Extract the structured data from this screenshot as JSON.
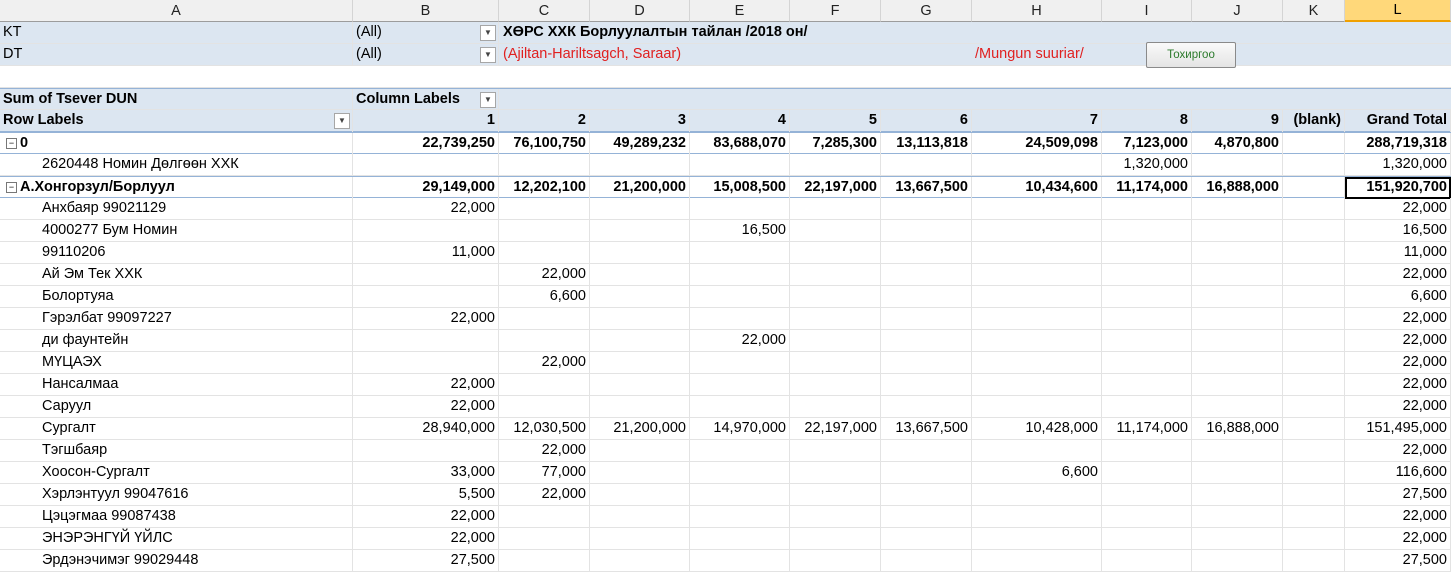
{
  "columns": [
    "A",
    "B",
    "C",
    "D",
    "E",
    "F",
    "G",
    "H",
    "I",
    "J",
    "K",
    "L"
  ],
  "filters": [
    {
      "name": "KT",
      "value": "(All)"
    },
    {
      "name": "DT",
      "value": "(All)"
    }
  ],
  "report_title": "ХӨРС ХХК Борлуулалтын тайлан /2018 он/",
  "report_subtitle": "(Ajiltan-Hariltsagch, Saraar)",
  "report_note": "/Mungun suuriar/",
  "button_label": "Тохиргоо",
  "pivot": {
    "value_field": "Sum of Tsever DUN",
    "column_labels": "Column Labels",
    "row_labels": "Row Labels",
    "col_headers": [
      "1",
      "2",
      "3",
      "4",
      "5",
      "6",
      "7",
      "8",
      "9",
      "(blank)",
      "Grand Total"
    ]
  },
  "rows": [
    {
      "label": "0",
      "kind": "group",
      "expand": "⊟",
      "vals": [
        "22,739,250",
        "76,100,750",
        "49,289,232",
        "83,688,070",
        "7,285,300",
        "13,113,818",
        "24,509,098",
        "7,123,000",
        "4,870,800",
        "",
        "288,719,318"
      ]
    },
    {
      "label": "2620448 Номин Дөлгөөн ХХК",
      "kind": "item",
      "vals": [
        "",
        "",
        "",
        "",
        "",
        "",
        "",
        "1,320,000",
        "",
        "",
        "1,320,000"
      ]
    },
    {
      "label": "А.Хонгорзул/Борлуул",
      "kind": "group",
      "expand": "⊟",
      "vals": [
        "29,149,000",
        "12,202,100",
        "21,200,000",
        "15,008,500",
        "22,197,000",
        "13,667,500",
        "10,434,600",
        "11,174,000",
        "16,888,000",
        "",
        "151,920,700"
      ]
    },
    {
      "label": " Анхбаяр 99021129",
      "kind": "item",
      "vals": [
        "22,000",
        "",
        "",
        "",
        "",
        "",
        "",
        "",
        "",
        "",
        "22,000"
      ]
    },
    {
      "label": "4000277 Бум Номин",
      "kind": "item",
      "vals": [
        "",
        "",
        "",
        "16,500",
        "",
        "",
        "",
        "",
        "",
        "",
        "16,500"
      ]
    },
    {
      "label": "99110206",
      "kind": "item",
      "vals": [
        "11,000",
        "",
        "",
        "",
        "",
        "",
        "",
        "",
        "",
        "",
        "11,000"
      ]
    },
    {
      "label": "Ай Эм Тек ХХК",
      "kind": "item",
      "vals": [
        "",
        "22,000",
        "",
        "",
        "",
        "",
        "",
        "",
        "",
        "",
        "22,000"
      ]
    },
    {
      "label": "Болортуяа",
      "kind": "item",
      "vals": [
        "",
        "6,600",
        "",
        "",
        "",
        "",
        "",
        "",
        "",
        "",
        "6,600"
      ]
    },
    {
      "label": "Гэрэлбат 99097227",
      "kind": "item",
      "vals": [
        "22,000",
        "",
        "",
        "",
        "",
        "",
        "",
        "",
        "",
        "",
        "22,000"
      ]
    },
    {
      "label": "ди фаунтейн",
      "kind": "item",
      "vals": [
        "",
        "",
        "",
        "22,000",
        "",
        "",
        "",
        "",
        "",
        "",
        "22,000"
      ]
    },
    {
      "label": "МҮЦАЭХ",
      "kind": "item",
      "vals": [
        "",
        "22,000",
        "",
        "",
        "",
        "",
        "",
        "",
        "",
        "",
        "22,000"
      ]
    },
    {
      "label": "Нансалмаа",
      "kind": "item",
      "vals": [
        "22,000",
        "",
        "",
        "",
        "",
        "",
        "",
        "",
        "",
        "",
        "22,000"
      ]
    },
    {
      "label": "Саруул",
      "kind": "item",
      "vals": [
        "22,000",
        "",
        "",
        "",
        "",
        "",
        "",
        "",
        "",
        "",
        "22,000"
      ]
    },
    {
      "label": "Сургалт",
      "kind": "item",
      "vals": [
        "28,940,000",
        "12,030,500",
        "21,200,000",
        "14,970,000",
        "22,197,000",
        "13,667,500",
        "10,428,000",
        "11,174,000",
        "16,888,000",
        "",
        "151,495,000"
      ]
    },
    {
      "label": "Тэгшбаяр",
      "kind": "item",
      "vals": [
        "",
        "22,000",
        "",
        "",
        "",
        "",
        "",
        "",
        "",
        "",
        "22,000"
      ]
    },
    {
      "label": "Хоосон-Сургалт",
      "kind": "item",
      "vals": [
        "33,000",
        "77,000",
        "",
        "",
        "",
        "",
        "6,600",
        "",
        "",
        "",
        "116,600"
      ]
    },
    {
      "label": "Хэрлэнтуул 99047616",
      "kind": "item",
      "vals": [
        "5,500",
        "22,000",
        "",
        "",
        "",
        "",
        "",
        "",
        "",
        "",
        "27,500"
      ]
    },
    {
      "label": "Цэцэгмаа 99087438",
      "kind": "item",
      "vals": [
        "22,000",
        "",
        "",
        "",
        "",
        "",
        "",
        "",
        "",
        "",
        "22,000"
      ]
    },
    {
      "label": "ЭНЭРЭНГҮЙ ҮЙЛС",
      "kind": "item",
      "vals": [
        "22,000",
        "",
        "",
        "",
        "",
        "",
        "",
        "",
        "",
        "",
        "22,000"
      ]
    },
    {
      "label": "Эрдэнэчимэг 99029448",
      "kind": "item",
      "vals": [
        "27,500",
        "",
        "",
        "",
        "",
        "",
        "",
        "",
        "",
        "",
        "27,500"
      ]
    }
  ]
}
